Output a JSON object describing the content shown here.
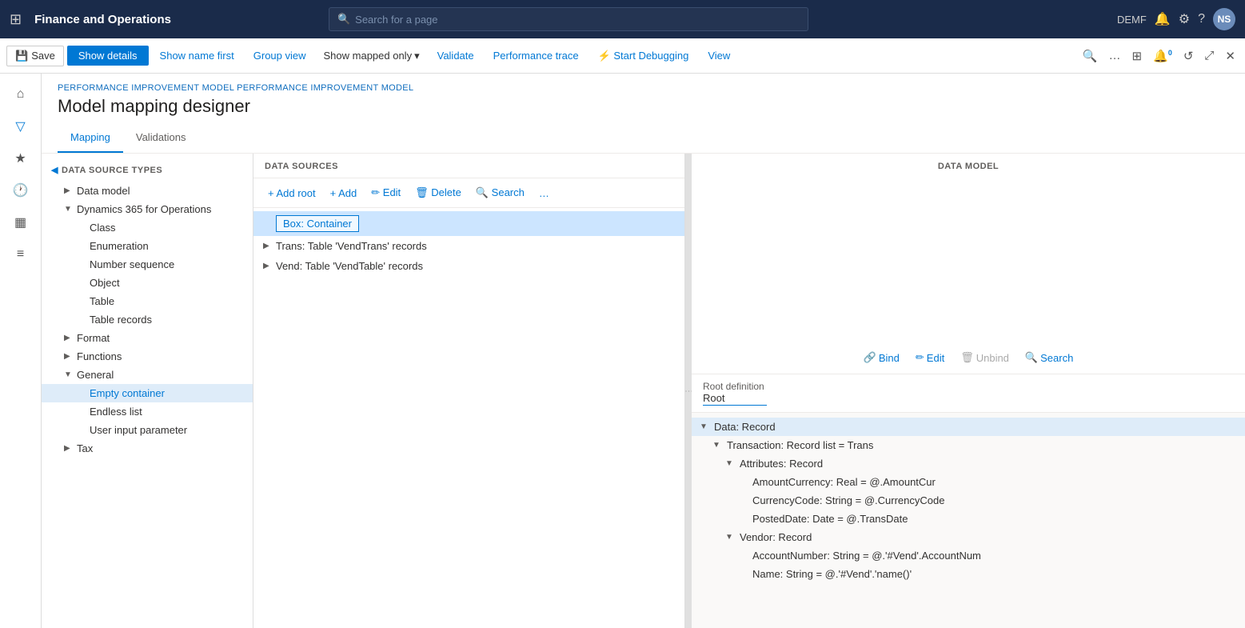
{
  "topNav": {
    "gridIcon": "⊞",
    "appTitle": "Finance and Operations",
    "searchPlaceholder": "Search for a page",
    "searchIcon": "🔍",
    "userEnv": "DEMF",
    "notificationIcon": "🔔",
    "settingsIcon": "⚙",
    "helpIcon": "?",
    "avatarText": "NS"
  },
  "toolbar": {
    "saveLabel": "Save",
    "showDetailsLabel": "Show details",
    "showNameFirstLabel": "Show name first",
    "groupViewLabel": "Group view",
    "showMappedOnlyLabel": "Show mapped only",
    "chevronIcon": "▾",
    "validateLabel": "Validate",
    "perfTraceLabel": "Performance trace",
    "startDebuggingLabel": "Start Debugging",
    "viewLabel": "View",
    "searchIcon": "🔍",
    "moreIcon": "…",
    "gridIcon": "⊞",
    "notifIcon": "🔔",
    "badgeCount": "0",
    "refreshIcon": "↺",
    "openIcon": "⤢",
    "closeIcon": "✕"
  },
  "sidebar": {
    "homeIcon": "⌂",
    "filterIcon": "▽",
    "favIcon": "★",
    "recentIcon": "🕐",
    "tableIcon": "▦",
    "listIcon": "≡"
  },
  "breadcrumb": "PERFORMANCE IMPROVEMENT MODEL PERFORMANCE IMPROVEMENT MODEL",
  "pageTitle": "Model mapping designer",
  "tabs": [
    {
      "label": "Mapping",
      "active": true
    },
    {
      "label": "Validations",
      "active": false
    }
  ],
  "dstPanel": {
    "header": "DATA SOURCE TYPES",
    "items": [
      {
        "label": "Data model",
        "indent": 1,
        "expandable": true,
        "expanded": false
      },
      {
        "label": "Dynamics 365 for Operations",
        "indent": 1,
        "expandable": true,
        "expanded": true
      },
      {
        "label": "Class",
        "indent": 2,
        "expandable": false
      },
      {
        "label": "Enumeration",
        "indent": 2,
        "expandable": false
      },
      {
        "label": "Number sequence",
        "indent": 2,
        "expandable": false
      },
      {
        "label": "Object",
        "indent": 2,
        "expandable": false
      },
      {
        "label": "Table",
        "indent": 2,
        "expandable": false
      },
      {
        "label": "Table records",
        "indent": 2,
        "expandable": false,
        "selected": false
      },
      {
        "label": "Format",
        "indent": 1,
        "expandable": true,
        "expanded": false
      },
      {
        "label": "Functions",
        "indent": 1,
        "expandable": true,
        "expanded": false
      },
      {
        "label": "General",
        "indent": 1,
        "expandable": true,
        "expanded": true
      },
      {
        "label": "Empty container",
        "indent": 2,
        "expandable": false,
        "selected": true
      },
      {
        "label": "Endless list",
        "indent": 2,
        "expandable": false
      },
      {
        "label": "User input parameter",
        "indent": 2,
        "expandable": false
      },
      {
        "label": "Tax",
        "indent": 1,
        "expandable": true,
        "expanded": false
      }
    ]
  },
  "dsPanel": {
    "header": "DATA SOURCES",
    "toolbar": {
      "addRootLabel": "+ Add root",
      "addLabel": "+ Add",
      "editLabel": "✏ Edit",
      "deleteLabel": "🗑 Delete",
      "searchLabel": "🔍 Search",
      "moreIcon": "…"
    },
    "items": [
      {
        "label": "Box: Container",
        "indent": 0,
        "expandable": false,
        "selected": true,
        "isBox": true
      },
      {
        "label": "Trans: Table 'VendTrans' records",
        "indent": 0,
        "expandable": true
      },
      {
        "label": "Vend: Table 'VendTable' records",
        "indent": 0,
        "expandable": true
      }
    ]
  },
  "dmPanel": {
    "header": "DATA MODEL",
    "toolbar": {
      "bindLabel": "Bind",
      "bindIcon": "🔗",
      "editLabel": "Edit",
      "editIcon": "✏",
      "unbindLabel": "Unbind",
      "unbindIcon": "🗑",
      "searchLabel": "Search",
      "searchIcon": "🔍"
    },
    "rootDefinitionLabel": "Root definition",
    "rootDefinitionValue": "Root",
    "items": [
      {
        "label": "Data: Record",
        "indent": 0,
        "expandable": true,
        "expanded": true,
        "selected": true
      },
      {
        "label": "Transaction: Record list = Trans",
        "indent": 1,
        "expandable": true,
        "expanded": true
      },
      {
        "label": "Attributes: Record",
        "indent": 2,
        "expandable": true,
        "expanded": true
      },
      {
        "label": "AmountCurrency: Real = @.AmountCur",
        "indent": 3,
        "expandable": false
      },
      {
        "label": "CurrencyCode: String = @.CurrencyCode",
        "indent": 3,
        "expandable": false
      },
      {
        "label": "PostedDate: Date = @.TransDate",
        "indent": 3,
        "expandable": false
      },
      {
        "label": "Vendor: Record",
        "indent": 2,
        "expandable": true,
        "expanded": true
      },
      {
        "label": "AccountNumber: String = @.'#Vend'.AccountNum",
        "indent": 3,
        "expandable": false
      },
      {
        "label": "Name: String = @.'#Vend'.'name()'",
        "indent": 3,
        "expandable": false
      }
    ]
  }
}
